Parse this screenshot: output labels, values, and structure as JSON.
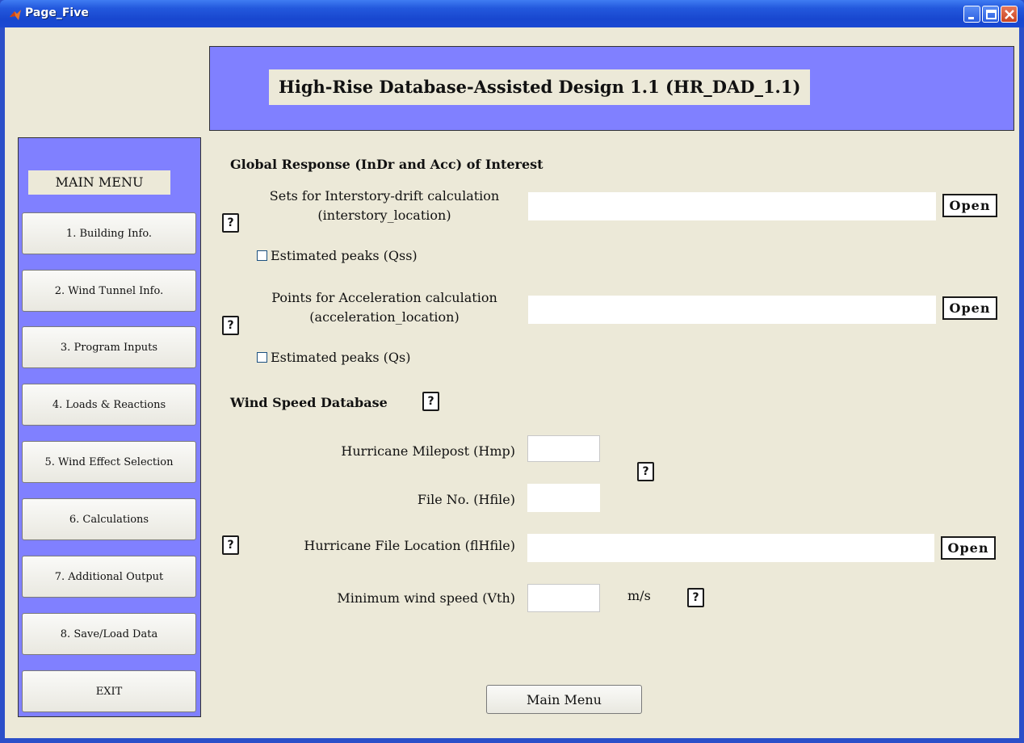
{
  "window": {
    "title": "Page_Five",
    "icons": {
      "app": "matlab-icon",
      "minimize": "minimize-icon",
      "maximize": "maximize-icon",
      "close": "close-icon"
    }
  },
  "header": {
    "title": "High-Rise Database-Assisted Design 1.1 (HR_DAD_1.1)"
  },
  "sidebar": {
    "label": "MAIN MENU",
    "items": [
      {
        "label": "1. Building Info."
      },
      {
        "label": "2. Wind Tunnel Info."
      },
      {
        "label": "3. Program Inputs"
      },
      {
        "label": "4. Loads & Reactions"
      },
      {
        "label": "5. Wind Effect Selection"
      },
      {
        "label": "6. Calculations"
      },
      {
        "label": "7.  Additional Output"
      },
      {
        "label": "8. Save/Load Data"
      },
      {
        "label": "EXIT"
      }
    ]
  },
  "global_response": {
    "title": "Global Response (InDr and Acc) of Interest",
    "interstory": {
      "label_line1": "Sets for Interstory-drift calculation",
      "label_line2": "(interstory_location)",
      "value": "",
      "open_label": "Open",
      "help_label": "?",
      "checkbox_label": "Estimated peaks (Qss)",
      "checked": false
    },
    "acceleration": {
      "label_line1": "Points for Acceleration calculation",
      "label_line2": "(acceleration_location)",
      "value": "",
      "open_label": "Open",
      "help_label": "?",
      "checkbox_label": "Estimated peaks (Qs)",
      "checked": false
    }
  },
  "wind_speed": {
    "title": "Wind Speed Database",
    "help_label": "?",
    "milepost": {
      "label": "Hurricane Milepost (Hmp)",
      "value": ""
    },
    "file_no": {
      "label": "File No. (Hfile)",
      "value": ""
    },
    "milepost_help_label": "?",
    "file_location": {
      "label": "Hurricane File Location (flHfile)",
      "value": "",
      "open_label": "Open",
      "help_label": "?"
    },
    "min_speed": {
      "label": "Minimum wind speed (Vth)",
      "value": "",
      "unit": "m/s",
      "help_label": "?"
    }
  },
  "footer": {
    "main_menu_label": "Main Menu"
  },
  "colors": {
    "panel": "#8080ff",
    "background": "#ece9d8",
    "titlebar": "#1f51d6"
  }
}
